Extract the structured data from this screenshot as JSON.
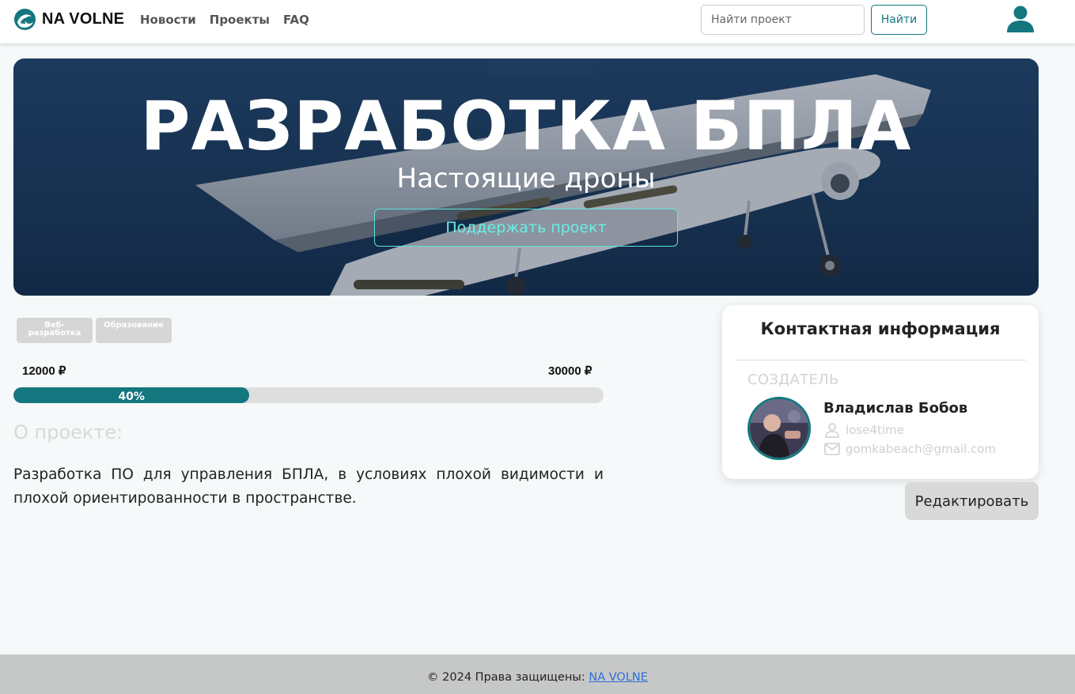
{
  "navbar": {
    "brand": "NA VOLNE",
    "links": [
      "Новости",
      "Проекты",
      "FAQ"
    ],
    "search_placeholder": "Найти проект",
    "search_button": "Найти"
  },
  "hero": {
    "title": "РАЗРАБОТКА БПЛА",
    "subtitle": "Настоящие дроны",
    "button": "Поддержать проект"
  },
  "tags": [
    "Веб-разработка",
    "Образование"
  ],
  "funding": {
    "current": "12000 ₽",
    "goal": "30000 ₽",
    "progress_label": "40%",
    "progress_fraction": 0.4
  },
  "about": {
    "heading": "О проекте:",
    "text": "Разработка ПО для управления БПЛА, в условиях плохой видимости и плохой ориентированности в пространстве."
  },
  "contact": {
    "title": "Контактная информация",
    "role": "СОЗДАТЕЛЬ",
    "name": "Владислав Бобов",
    "username": "lose4time",
    "email": "gomkabeach@gmail.com",
    "username_icon": "person-icon",
    "email_icon": "mail-icon"
  },
  "edit_button": "Редактировать",
  "footer": {
    "text": "© 2024 Права защищены: ",
    "link": "NA VOLNE"
  },
  "colors": {
    "accent": "#147780",
    "hero_button": "#66efe6",
    "footer_link": "#2f6fd6"
  }
}
